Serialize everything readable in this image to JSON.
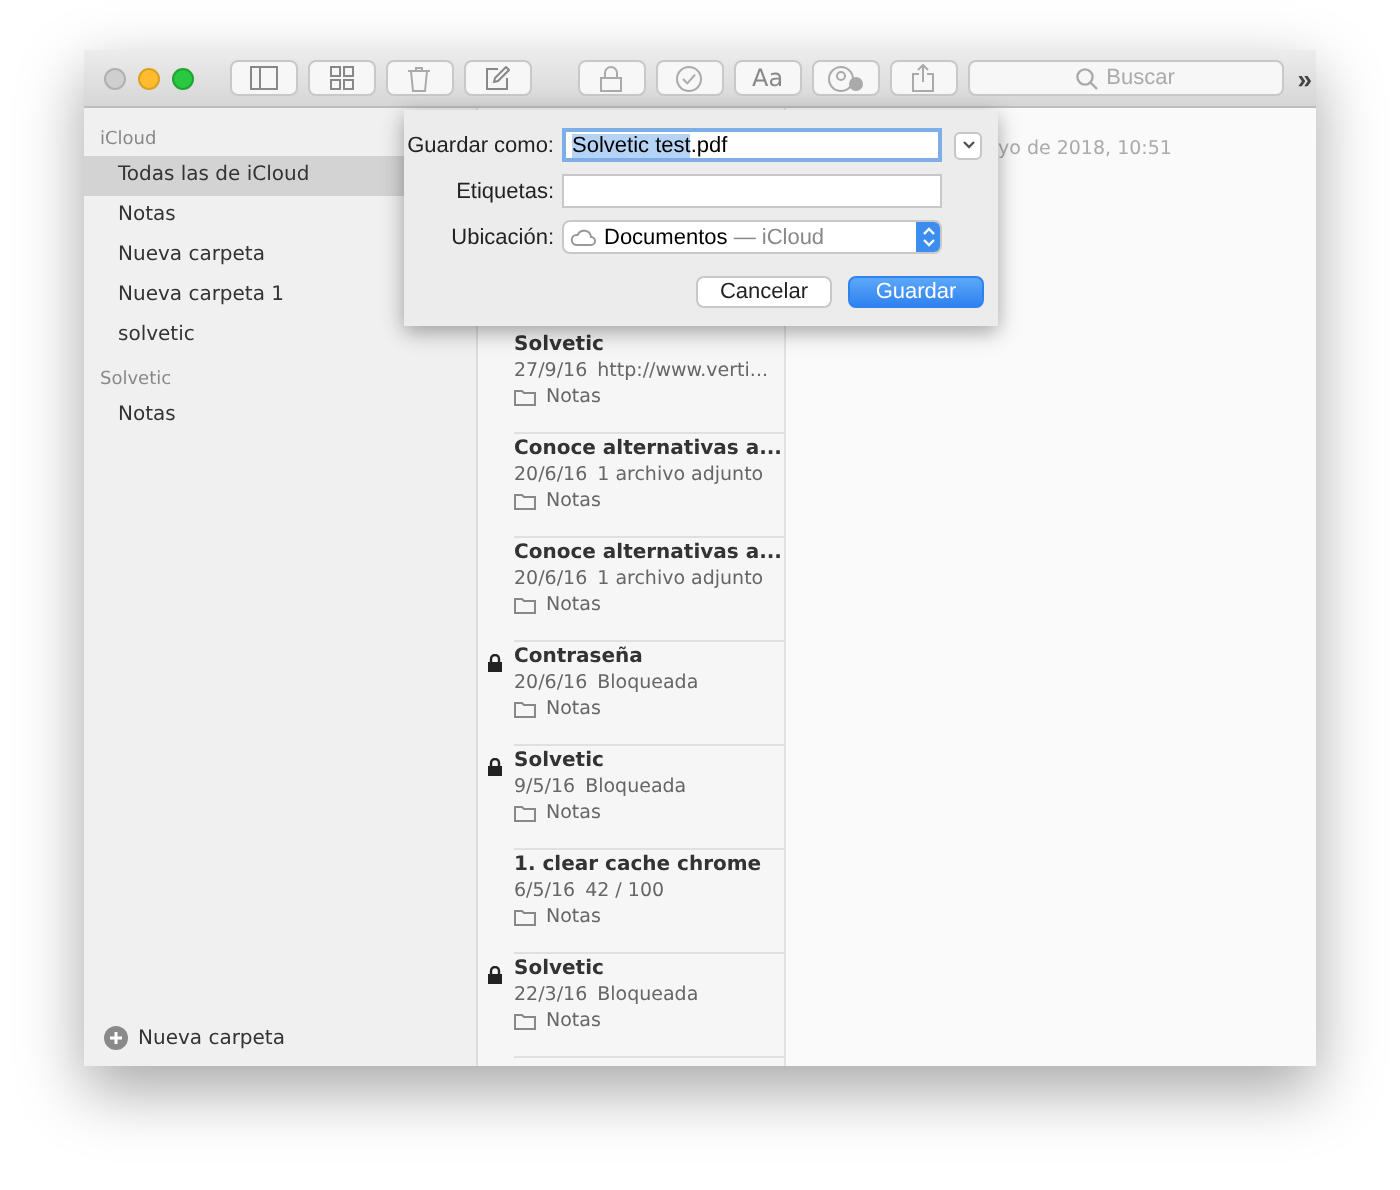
{
  "window": {
    "traffic_lights": [
      {
        "kind": "close",
        "disabled": true
      },
      {
        "kind": "minimize",
        "disabled": false
      },
      {
        "kind": "zoom",
        "disabled": false
      }
    ]
  },
  "toolbar": {
    "buttons": [
      {
        "kind": "sidebar"
      },
      {
        "kind": "grid"
      },
      {
        "kind": "trash"
      },
      {
        "kind": "compose"
      },
      {
        "kind": "lock"
      },
      {
        "kind": "check"
      },
      {
        "kind": "font",
        "label": "Aa"
      },
      {
        "kind": "share-people"
      },
      {
        "kind": "share"
      }
    ],
    "search": {
      "placeholder": "Buscar"
    },
    "overflow": "»"
  },
  "sidebar": {
    "sections": [
      {
        "heading": "iCloud",
        "items": [
          {
            "label": "Todas las de iCloud",
            "selected": true
          },
          {
            "label": "Notas",
            "selected": false
          },
          {
            "label": "Nueva carpeta",
            "selected": false
          },
          {
            "label": "Nueva carpeta 1",
            "selected": false
          },
          {
            "label": "solvetic",
            "selected": false
          }
        ]
      },
      {
        "heading": "Solvetic",
        "items": [
          {
            "label": "Notas",
            "selected": false
          }
        ]
      }
    ],
    "new_folder": "Nueva carpeta"
  },
  "notes": [
    {
      "title": "Solvetic",
      "date": "27/9/16",
      "detail": "http://www.verti...",
      "folder": "Notas",
      "locked": false
    },
    {
      "title": "Conoce alternativas a...",
      "date": "20/6/16",
      "detail": "1 archivo adjunto",
      "folder": "Notas",
      "locked": false
    },
    {
      "title": "Conoce alternativas a...",
      "date": "20/6/16",
      "detail": "1 archivo adjunto",
      "folder": "Notas",
      "locked": false
    },
    {
      "title": "Contraseña",
      "date": "20/6/16",
      "detail": "Bloqueada",
      "folder": "Notas",
      "locked": true
    },
    {
      "title": "Solvetic",
      "date": "9/5/16",
      "detail": "Bloqueada",
      "folder": "Notas",
      "locked": true
    },
    {
      "title": "1. clear cache chrome",
      "date": "6/5/16",
      "detail": "42 / 100",
      "folder": "Notas",
      "locked": false
    },
    {
      "title": "Solvetic",
      "date": "22/3/16",
      "detail": "Bloqueada",
      "folder": "Notas",
      "locked": true
    }
  ],
  "content": {
    "date": "yo de 2018, 10:51"
  },
  "dialog": {
    "save_as_label": "Guardar como:",
    "save_as_parts": [
      {
        "text": "Solvetic test",
        "selected": true
      },
      {
        "text": ".pdf",
        "selected": false
      }
    ],
    "tags_label": "Etiquetas:",
    "location_label": "Ubicación:",
    "location": "Documentos",
    "location_service": "— iCloud",
    "cancel": "Cancelar",
    "save": "Guardar"
  }
}
